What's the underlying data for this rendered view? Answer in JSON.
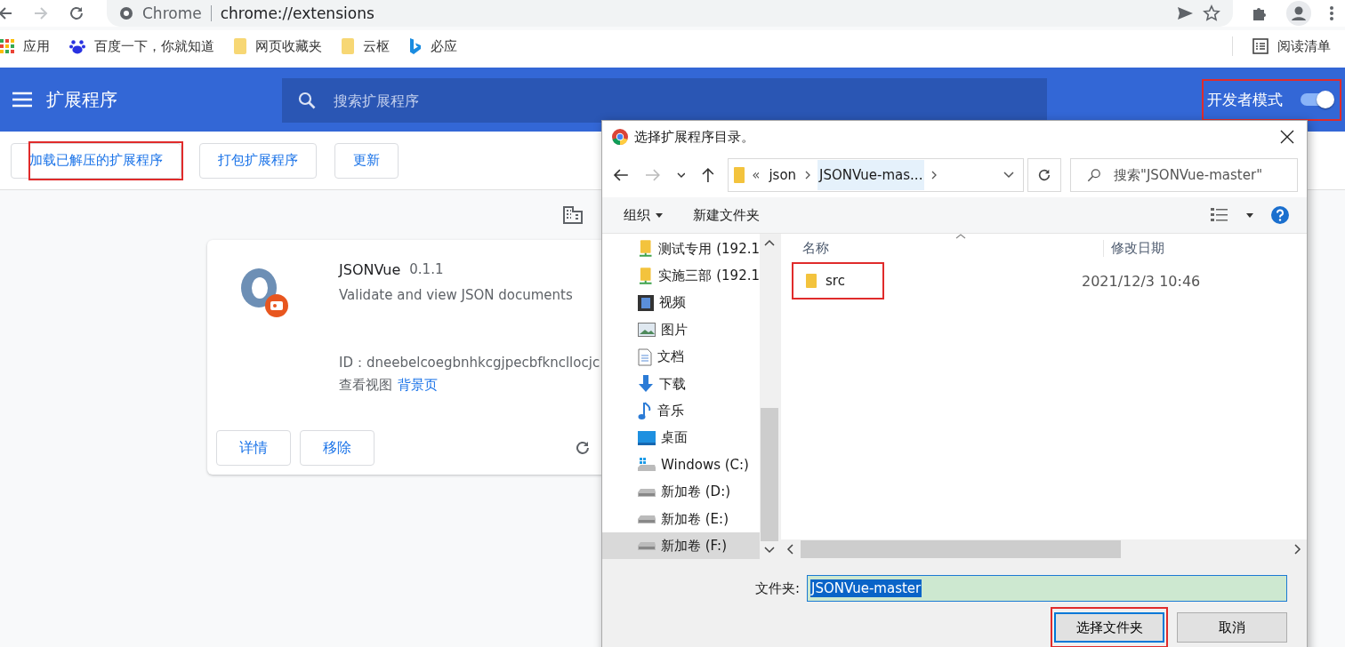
{
  "browser": {
    "forward": {
      "disabled": true
    },
    "address": {
      "site_label": "Chrome",
      "url": "chrome://extensions"
    }
  },
  "bookmarks": [
    {
      "kind": "apps",
      "label": "应用"
    },
    {
      "kind": "paw",
      "label": "百度一下，你就知道"
    },
    {
      "kind": "folder",
      "label": "网页收藏夹"
    },
    {
      "kind": "folder",
      "label": "云枢"
    },
    {
      "kind": "bing",
      "label": "必应"
    }
  ],
  "reading_list": "阅读清单",
  "header": {
    "title": "扩展程序",
    "search_placeholder": "搜索扩展程序",
    "dev_mode": {
      "label": "开发者模式",
      "on": true,
      "marked": true
    }
  },
  "toolbar_buttons": [
    {
      "label": "加载已解压的扩展程序",
      "marked": true
    },
    {
      "label": "打包扩展程序",
      "marked": false
    },
    {
      "label": "更新",
      "marked": false
    }
  ],
  "extension_card": {
    "name": "JSONVue",
    "version": "0.1.1",
    "description": "Validate and view JSON documents",
    "id_line": "ID：dneebelcoegbnhkcgjpecbfkncllocjc",
    "views_label": "查看视图",
    "view_link": "背景页",
    "buttons": [
      "详情",
      "移除"
    ]
  },
  "dialog": {
    "title": "选择扩展程序目录。",
    "breadcrumb_prefix": "«",
    "breadcrumb": [
      {
        "label": "json",
        "selected": false
      },
      {
        "label": "JSONVue-mas...",
        "selected": true
      }
    ],
    "search_placeholder": "搜索\"JSONVue-master\"",
    "commands": [
      {
        "label": "组织",
        "dropdown": true
      },
      {
        "label": "新建文件夹",
        "dropdown": false
      }
    ],
    "nav_items": [
      {
        "kind": "network-folder",
        "label": "测试专用 (192.1",
        "selected": false
      },
      {
        "kind": "network-folder",
        "label": "实施三部 (192.1",
        "selected": false
      },
      {
        "kind": "video",
        "label": "视频",
        "selected": false
      },
      {
        "kind": "picture",
        "label": "图片",
        "selected": false
      },
      {
        "kind": "document",
        "label": "文档",
        "selected": false
      },
      {
        "kind": "download",
        "label": "下载",
        "selected": false
      },
      {
        "kind": "music",
        "label": "音乐",
        "selected": false
      },
      {
        "kind": "desktop",
        "label": "桌面",
        "selected": false
      },
      {
        "kind": "system-drive",
        "label": "Windows  (C:)",
        "selected": false
      },
      {
        "kind": "drive",
        "label": "新加卷 (D:)",
        "selected": false
      },
      {
        "kind": "drive",
        "label": "新加卷 (E:)",
        "selected": false
      },
      {
        "kind": "drive",
        "label": "新加卷 (F:)",
        "selected": true
      }
    ],
    "columns": [
      "名称",
      "修改日期"
    ],
    "files": [
      {
        "name": "src",
        "modified": "2021/12/3 10:46",
        "marked": true
      }
    ],
    "folder_label": "文件夹:",
    "folder_value": "JSONVue-master",
    "buttons": [
      {
        "label": "选择文件夹",
        "kind": "primary",
        "marked": true
      },
      {
        "label": "取消",
        "kind": "normal",
        "marked": false
      }
    ]
  }
}
